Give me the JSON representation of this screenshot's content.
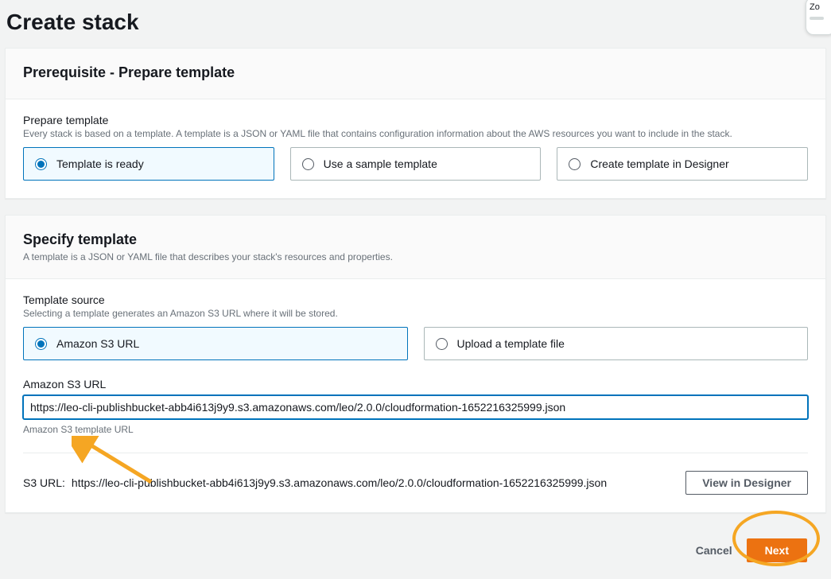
{
  "page": {
    "title": "Create stack"
  },
  "corner": {
    "text": "Zo"
  },
  "prereq": {
    "title": "Prerequisite - Prepare template",
    "section_label": "Prepare template",
    "section_help": "Every stack is based on a template. A template is a JSON or YAML file that contains configuration information about the AWS resources you want to include in the stack.",
    "options": {
      "ready": "Template is ready",
      "sample": "Use a sample template",
      "designer": "Create template in Designer"
    }
  },
  "specify": {
    "title": "Specify template",
    "subtitle": "A template is a JSON or YAML file that describes your stack's resources and properties.",
    "source_label": "Template source",
    "source_help": "Selecting a template generates an Amazon S3 URL where it will be stored.",
    "options": {
      "s3": "Amazon S3 URL",
      "upload": "Upload a template file"
    },
    "url_label": "Amazon S3 URL",
    "url_value": "https://leo-cli-publishbucket-abb4i613j9y9.s3.amazonaws.com/leo/2.0.0/cloudformation-1652216325999.json",
    "url_help": "Amazon S3 template URL",
    "s3_row_label": "S3 URL:",
    "s3_row_value": "https://leo-cli-publishbucket-abb4i613j9y9.s3.amazonaws.com/leo/2.0.0/cloudformation-1652216325999.json",
    "view_designer": "View in Designer"
  },
  "footer": {
    "cancel": "Cancel",
    "next": "Next"
  }
}
